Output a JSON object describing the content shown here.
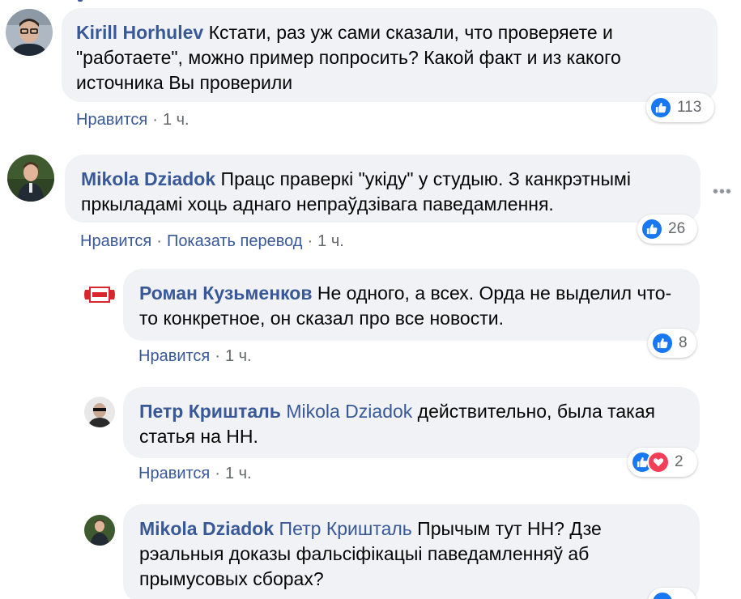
{
  "comments": [
    {
      "author": "Kirill Horhulev",
      "text": "Кстати, раз уж сами сказали, что проверяете и \"работаете\", можно пример попросить? Какой факт и из какого источника Вы проверили",
      "like_label": "Нравится",
      "time": "1 ч.",
      "reaction_count": "113"
    },
    {
      "author": "Mikola Dziadok",
      "text": "Працс праверкі \"укіду\" у студыю. З канкрэтнымі пркыладамі хоць аднаго непраўдзівага паведамлення.",
      "like_label": "Нравится",
      "translate_label": "Показать перевод",
      "time": "1 ч.",
      "reaction_count": "26"
    },
    {
      "author": "Роман Кузьменков",
      "text": "Не одного, а всех. Орда не выделил что-то конкретное, он сказал про все новости.",
      "like_label": "Нравится",
      "time": "1 ч.",
      "reaction_count": "8"
    },
    {
      "author": "Петр Кришталь",
      "mention": "Mikola Dziadok",
      "text": "действительно, была такая статья на НН.",
      "like_label": "Нравится",
      "time": "1 ч.",
      "reaction_count": "2"
    },
    {
      "author": "Mikola Dziadok",
      "mention": "Петр Кришталь",
      "text": "Прычым тут НН? Дзе рэальныя доказы фальсіфікацыі паведамленняў аб прымусовых сборах?"
    }
  ],
  "more_options": "•••",
  "colors": {
    "bubble_bg": "#f0f2f5",
    "author": "#385898",
    "like_blue": "#1877f2",
    "love_red": "#f33e58",
    "meta_gray": "#65676b"
  }
}
